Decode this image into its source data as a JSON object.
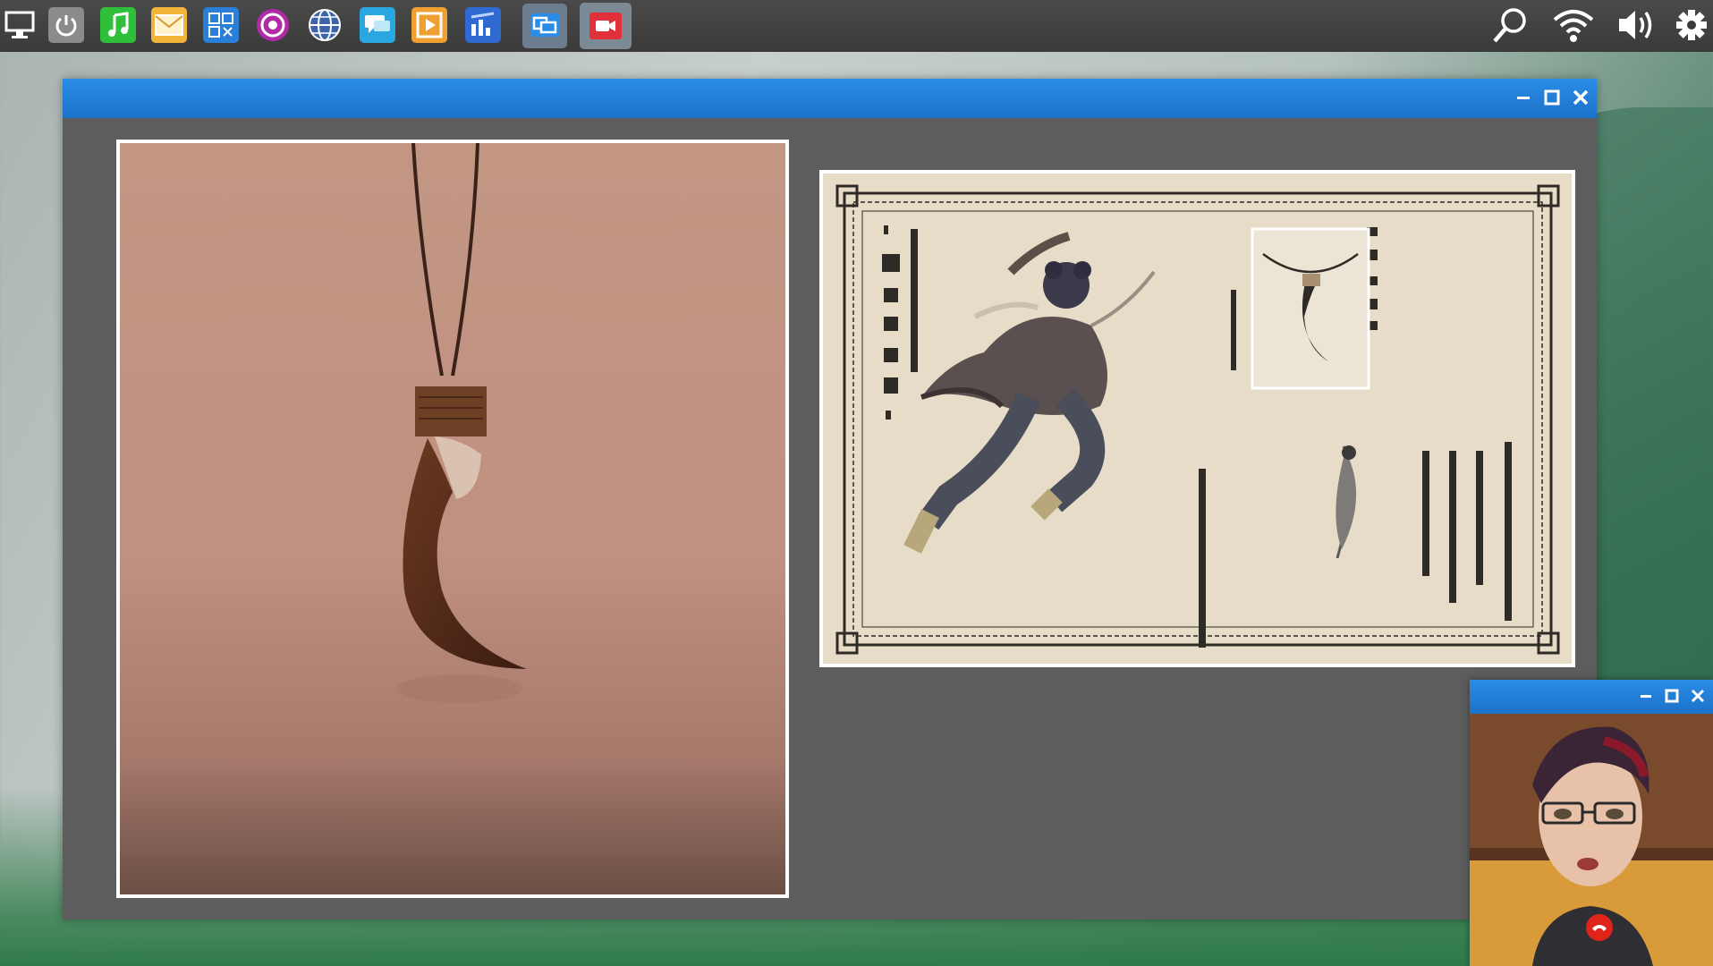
{
  "taskbar": {
    "apps": [
      {
        "name": "computer-icon",
        "color": "#ffffff"
      },
      {
        "name": "power-icon",
        "color": "#9a9a9a"
      },
      {
        "name": "music-icon",
        "color": "#2fbf3a"
      },
      {
        "name": "mail-icon",
        "color": "#f3b43a"
      },
      {
        "name": "calculator-icon",
        "color": "#2a7fd8"
      },
      {
        "name": "target-icon",
        "color": "#b12aa6"
      },
      {
        "name": "globe-icon",
        "color": "#4a6fb0"
      },
      {
        "name": "chat-icon",
        "color": "#2aa7e0"
      },
      {
        "name": "media-player-icon",
        "color": "#f0a030"
      },
      {
        "name": "chart-app-icon",
        "color": "#2f6ad0"
      },
      {
        "name": "window-switcher-icon",
        "color": "#2a8ce6"
      },
      {
        "name": "video-camera-icon",
        "color": "#e0303a"
      }
    ],
    "tray": [
      "search-icon",
      "wifi-icon",
      "volume-icon",
      "settings-gear-icon"
    ]
  },
  "main_window": {
    "controls": [
      "minimize-icon",
      "maximize-icon",
      "close-icon"
    ],
    "accent": "#1f7fd8"
  },
  "call_window": {
    "controls": [
      "minimize-icon",
      "maximize-icon",
      "close-icon"
    ],
    "hangup_color": "#e0241b"
  }
}
